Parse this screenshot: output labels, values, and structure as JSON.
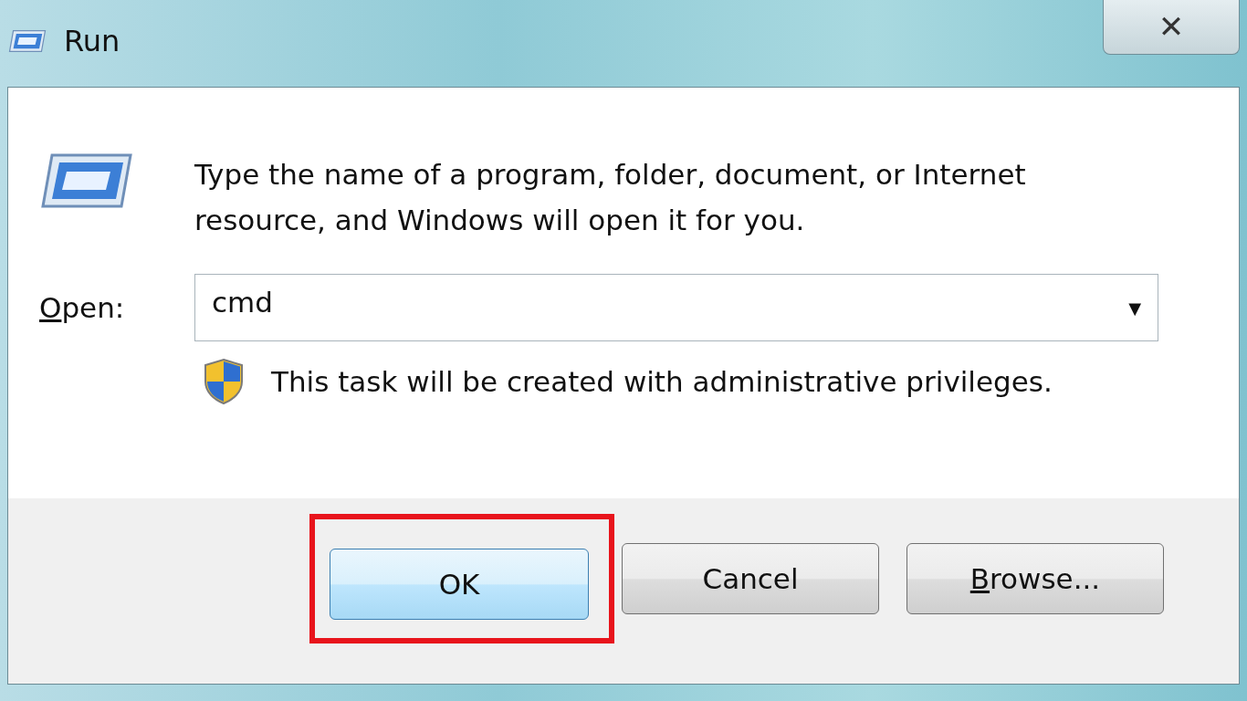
{
  "window": {
    "title": "Run",
    "close": "✕"
  },
  "description": "Type the name of a program, folder, document, or Internet resource, and Windows will open it for you.",
  "open_field": {
    "label": "Open:",
    "underline_first": true,
    "value": "cmd",
    "dropdown": "▼"
  },
  "notice": "This task will be created with administrative privileges.",
  "buttons": [
    {
      "label": "OK",
      "default": true,
      "highlighted": true,
      "underline_first": false
    },
    {
      "label": "Cancel",
      "default": false,
      "highlighted": false,
      "underline_first": false
    },
    {
      "label": "Browse...",
      "default": false,
      "highlighted": false,
      "underline_first": true
    }
  ]
}
